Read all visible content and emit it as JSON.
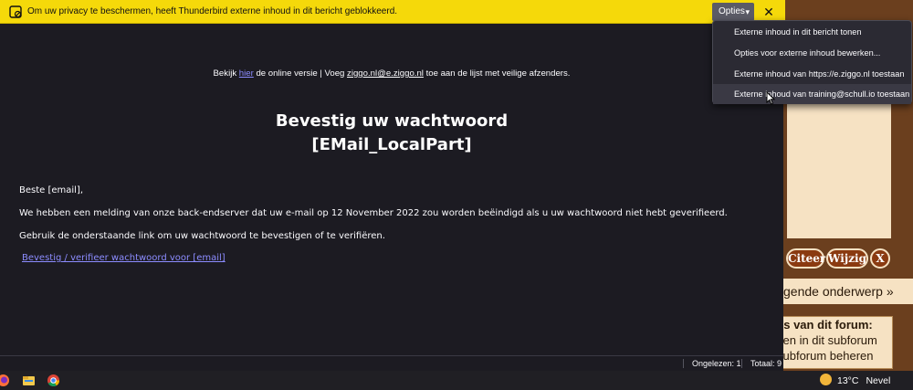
{
  "notification": {
    "message": "Om uw privacy te beschermen, heeft Thunderbird externe inhoud in dit bericht geblokkeerd.",
    "options_label": "Opties",
    "close_symbol": "✕"
  },
  "options_menu": {
    "items": [
      {
        "label": "Externe inhoud in dit bericht tonen"
      },
      {
        "label": "Opties voor externe inhoud bewerken..."
      },
      {
        "label": "Externe inhoud van https://e.ziggo.nl toestaan"
      },
      {
        "label": "Externe inhoud van training@schull.io toestaan"
      }
    ]
  },
  "mail": {
    "top_prefix": "Bekijk ",
    "top_link": "hier",
    "top_mid": " de online versie  | Voeg ",
    "top_email": "ziggo.nl@e.ziggo.nl",
    "top_suffix": " toe aan de lijst met  veilige  afzenders.",
    "heading_1": "Bevestig uw wachtwoord",
    "heading_2": "[EMail_LocalPart]",
    "greeting": "Beste  [email],",
    "paragraph_1": "We hebben een melding van onze back-endserver dat uw e-mail op 12 November 2022 zou worden beëindigd als u uw wachtwoord niet hebt geverifieerd.",
    "paragraph_2": "Gebruik de onderstaande link om uw wachtwoord te bevestigen of te verifiëren.",
    "verify_link": "Bevestig / verifieer wachtwoord voor [email]"
  },
  "status_bar": {
    "unread": "Ongelezen: 1",
    "total": "Totaal: 9"
  },
  "forum": {
    "buttons": [
      "Citeer",
      "Wijzig",
      "X"
    ],
    "next_topic": "gende onderwerp »",
    "permissions_title": "es van dit forum:",
    "permissions_line_1": "sen in dit subforum",
    "permissions_line_2": "subforum beheren"
  },
  "taskbar": {
    "icons": [
      "firefox-icon",
      "file-explorer-icon",
      "chrome-icon"
    ],
    "temperature": "13°C",
    "condition": "Nevel"
  },
  "colors": {
    "notification_bg": "#f5d90a",
    "mail_bg": "#1c1b22",
    "link": "#8c8cff",
    "menu_bg": "#2b2a33",
    "forum_bg": "#f6e2c3",
    "forum_dark": "#6b3f1e"
  }
}
